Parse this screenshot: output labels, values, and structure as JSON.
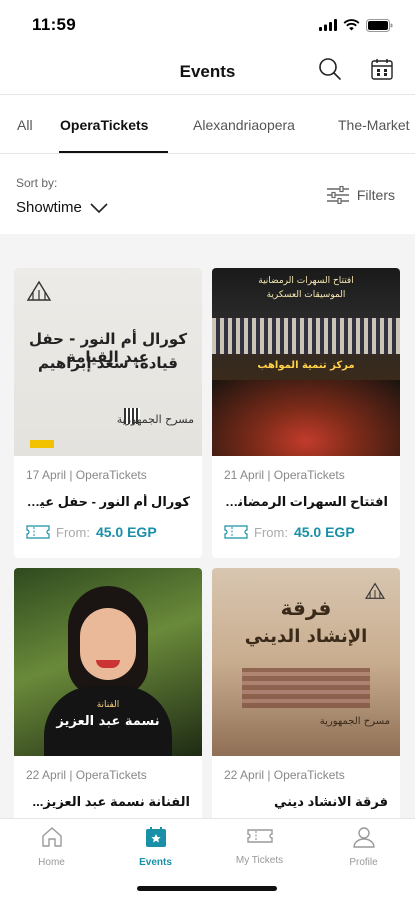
{
  "status": {
    "time": "11:59"
  },
  "header": {
    "title": "Events"
  },
  "tabs": [
    {
      "label": "All"
    },
    {
      "label": "OperaTickets"
    },
    {
      "label": "Alexandriaopera"
    },
    {
      "label": "The-Market"
    }
  ],
  "sort": {
    "label": "Sort by:",
    "value": "Showtime"
  },
  "filters": {
    "label": "Filters"
  },
  "events": [
    {
      "meta": "17 April | OperaTickets",
      "title": "كورال أم النور - حفل عيد...",
      "from": "From:",
      "price": "45.0 EGP",
      "poster": {
        "line1": "كورال أم النور - حفل عيد القيامة",
        "line2": "قيادة: سعد إبراهيم",
        "venue": "مسرح الجمهورية"
      }
    },
    {
      "meta": "21 April | OperaTickets",
      "title": "افتتاح السهرات الرمضانية...",
      "from": "From:",
      "price": "45.0 EGP",
      "poster": {
        "line1": "افتتاح السهرات الرمضانية",
        "line2": "الموسيقات العسكرية",
        "venue": "مركز تنمية المواهب"
      }
    },
    {
      "meta": "22 April | OperaTickets",
      "title": "الفنانة نسمة عبد العزيز...",
      "poster": {
        "line1": "نسمة عبد العزيز",
        "line2": "الفنانة"
      }
    },
    {
      "meta": "22 April | OperaTickets",
      "title": "فرقة الانشاد ديني",
      "poster": {
        "line1": "فرقة",
        "line2": "الإنشاد الديني",
        "venue": "مسرح الجمهورية"
      }
    }
  ],
  "nav": [
    {
      "label": "Home",
      "icon": "home-icon"
    },
    {
      "label": "Events",
      "icon": "events-icon"
    },
    {
      "label": "My Tickets",
      "icon": "ticket-icon"
    },
    {
      "label": "Profile",
      "icon": "profile-icon"
    }
  ],
  "colors": {
    "accent": "#1a8fa8",
    "background": "#f4f4f4"
  }
}
